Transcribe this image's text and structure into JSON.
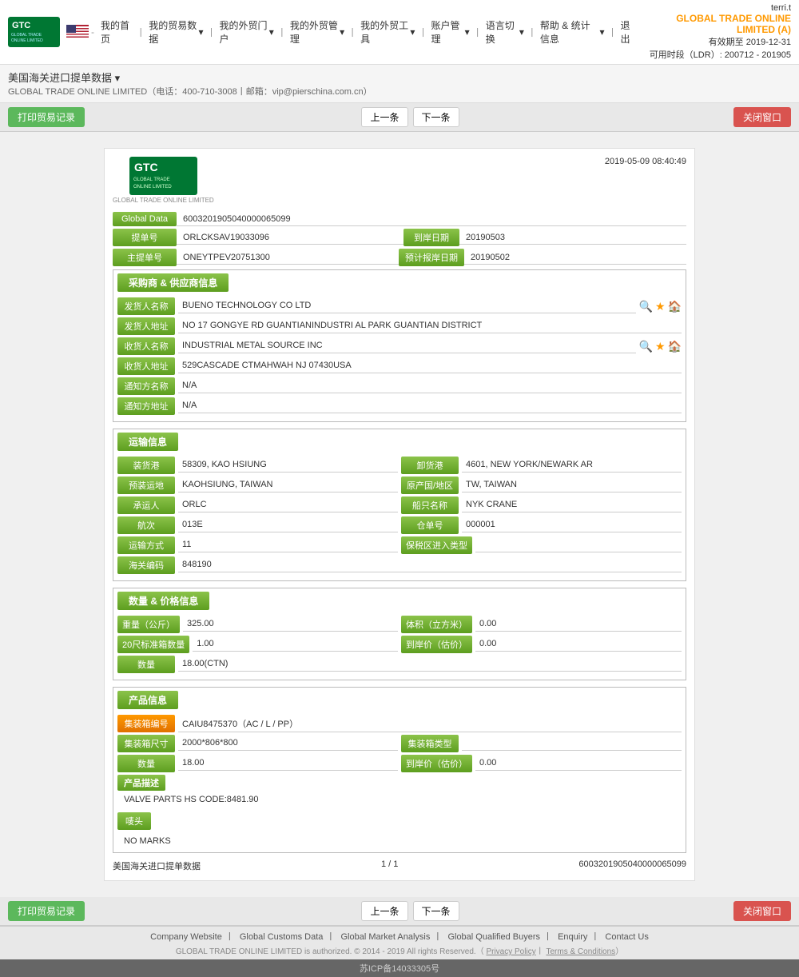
{
  "site": {
    "title": "美国海关进口提单数据",
    "user": "terri.t",
    "brand_name": "GLOBAL TRADE ONLINE LIMITED (A)",
    "valid_until": "有效期至 2019-12-31",
    "ldr": "可用时段（LDR）: 200712 - 201905",
    "company_full": "GLOBAL TRADE ONLINE LIMITED（电话：400-710-3008丨邮箱：vip@pierschina.com.cn）"
  },
  "nav": {
    "home": "我的首页",
    "my_import": "我的贸易数据",
    "my_export": "我的外贸门户",
    "my_foreign": "我的外贸管理",
    "my_tool": "我的外贸工具",
    "account": "账户管理",
    "language": "语言切换",
    "help": "帮助 & 统计信息",
    "logout": "退出"
  },
  "toolbar": {
    "print_label": "打印贸易记录",
    "prev_label": "上一条",
    "next_label": "下一条",
    "close_label": "关闭窗口"
  },
  "document": {
    "timestamp": "2019-05-09 08:40:49",
    "logo_sub": "GLOBAL TRADE ONLINE LIMITED",
    "global_data_label": "Global Data",
    "global_data_value": "6003201905040000065099",
    "bill_no_label": "提单号",
    "bill_no_value": "ORLCKSAV19033096",
    "arrival_date_label": "到岸日期",
    "arrival_date_value": "20190503",
    "master_bill_label": "主提单号",
    "master_bill_value": "ONEYTPEV20751300",
    "estimate_date_label": "预计报岸日期",
    "estimate_date_value": "20190502"
  },
  "buyer_seller": {
    "section_label": "采购商 & 供应商信息",
    "shipper_name_label": "发货人名称",
    "shipper_name_value": "BUENO TECHNOLOGY CO LTD",
    "shipper_addr_label": "发货人地址",
    "shipper_addr_value": "NO 17 GONGYE RD GUANTIANINDUSTRI AL PARK GUANTIAN DISTRICT",
    "receiver_name_label": "收货人名称",
    "receiver_name_value": "INDUSTRIAL METAL SOURCE INC",
    "receiver_addr_label": "收货人地址",
    "receiver_addr_value": "529CASCADE CTMAHWAH NJ 07430USA",
    "notify_name_label": "通知方名称",
    "notify_name_value": "N/A",
    "notify_addr_label": "通知方地址",
    "notify_addr_value": "N/A"
  },
  "transport": {
    "section_label": "运输信息",
    "departure_port_label": "装货港",
    "departure_port_value": "58309, KAO HSIUNG",
    "arrival_port_label": "卸货港",
    "arrival_port_value": "4601, NEW YORK/NEWARK AR",
    "pre_load_label": "预装运地",
    "pre_load_value": "KAOHSIUNG, TAIWAN",
    "origin_label": "原产国/地区",
    "origin_value": "TW, TAIWAN",
    "carrier_label": "承运人",
    "carrier_value": "ORLC",
    "vessel_label": "船只名称",
    "vessel_value": "NYK CRANE",
    "voyage_label": "航次",
    "voyage_value": "013E",
    "storage_label": "仓单号",
    "storage_value": "000001",
    "transport_mode_label": "运输方式",
    "transport_mode_value": "11",
    "bonded_label": "保税区进入类型",
    "bonded_value": "",
    "customs_code_label": "海关编码",
    "customs_code_value": "848190"
  },
  "quantity_price": {
    "section_label": "数量 & 价格信息",
    "weight_label": "重量（公斤）",
    "weight_value": "325.00",
    "volume_label": "体积（立方米）",
    "volume_value": "0.00",
    "container20_label": "20尺标准箱数量",
    "container20_value": "1.00",
    "arrival_price_label": "到岸价（估价）",
    "arrival_price_value": "0.00",
    "quantity_label": "数量",
    "quantity_value": "18.00(CTN)"
  },
  "product": {
    "section_label": "产品信息",
    "container_no_label": "集装箱编号",
    "container_no_value": "CAIU8475370（AC / L / PP）",
    "container_size_label": "集装箱尺寸",
    "container_size_value": "2000*806*800",
    "container_type_label": "集装箱类型",
    "container_type_value": "",
    "quantity_label": "数量",
    "quantity_value": "18.00",
    "arrival_price_label": "到岸价（估价）",
    "arrival_price_value": "0.00",
    "desc_label": "产品描述",
    "desc_value": "VALVE PARTS HS CODE:8481.90",
    "marks_label": "唛头",
    "marks_value": "NO MARKS"
  },
  "page_footer": {
    "data_source": "美国海关进口提单数据",
    "page_info": "1 / 1",
    "doc_id": "6003201905040000065099"
  },
  "site_footer": {
    "links": [
      "Company Website",
      "Global Customs Data",
      "Global Market Analysis",
      "Global Qualified Buyers",
      "Enquiry",
      "Contact Us"
    ],
    "copyright": "GLOBAL TRADE ONLINE LIMITED is authorized. © 2014 - 2019 All rights Reserved.（Privacy Policy丨Terms & Conditions）",
    "icp": "苏ICP备14033305号"
  }
}
